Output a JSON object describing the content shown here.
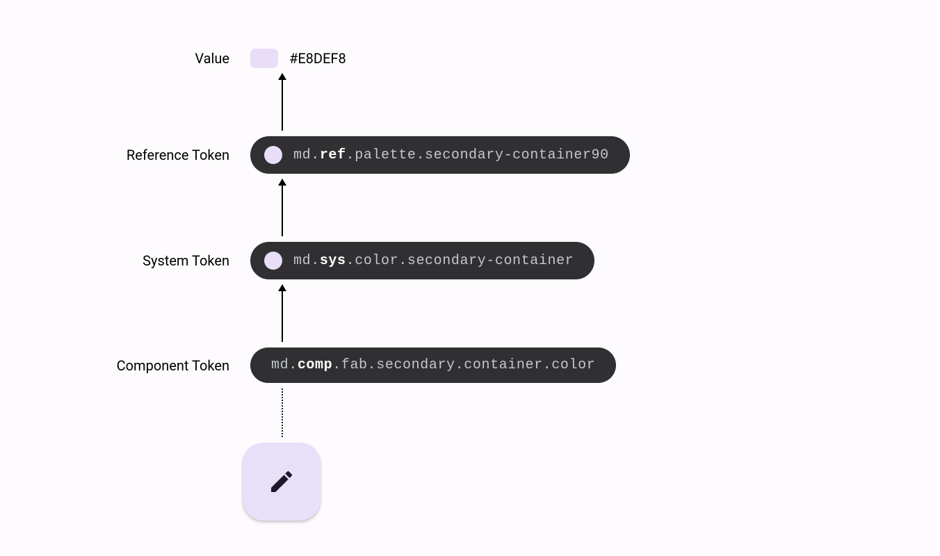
{
  "labels": {
    "value": "Value",
    "reference": "Reference Token",
    "system": "System Token",
    "component": "Component Token"
  },
  "value": {
    "hex": "#E8DEF8",
    "swatch_color": "#E8DEF8"
  },
  "tokens": {
    "reference": {
      "prefix": "md.",
      "bold": "ref",
      "suffix": ".palette.secondary-container90"
    },
    "system": {
      "prefix": "md.",
      "bold": "sys",
      "suffix": ".color.secondary-container"
    },
    "component": {
      "prefix": "md.",
      "bold": "comp",
      "suffix": ".fab.secondary.container.color"
    }
  },
  "colors": {
    "pill_bg": "#303033",
    "circle_fill": "#E8DEF8",
    "fab_bg": "#E8DFF8",
    "fab_icon": "#1D192B"
  }
}
